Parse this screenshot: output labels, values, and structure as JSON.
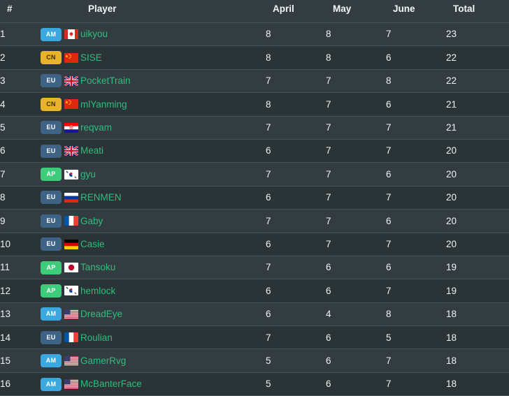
{
  "table": {
    "columns": [
      {
        "key": "rank",
        "label": "#"
      },
      {
        "key": "player",
        "label": "Player"
      },
      {
        "key": "april",
        "label": "April"
      },
      {
        "key": "may",
        "label": "May"
      },
      {
        "key": "june",
        "label": "June"
      },
      {
        "key": "total",
        "label": "Total"
      }
    ],
    "colors": {
      "page_background": "#343d41",
      "row_odd": "#333d41",
      "row_even": "#2a3336",
      "row_separator": "#4a5357",
      "header_text": "#f2f6f7",
      "body_text": "#eef2f4",
      "player_link": "#2fbd7e",
      "badge_am": "#3ba9e0",
      "badge_cn": "#e8b22a",
      "badge_eu": "#3f6384",
      "badge_ap": "#3dcc79"
    },
    "rows": [
      {
        "rank": "1",
        "region": "AM",
        "flag": "ca",
        "flag_name": "flag-canada",
        "player": "uikyou",
        "april": "8",
        "may": "8",
        "june": "7",
        "total": "23"
      },
      {
        "rank": "2",
        "region": "CN",
        "flag": "cn",
        "flag_name": "flag-china",
        "player": "SISE",
        "april": "8",
        "may": "8",
        "june": "6",
        "total": "22"
      },
      {
        "rank": "3",
        "region": "EU",
        "flag": "gb",
        "flag_name": "flag-united-kingdom",
        "player": "PocketTrain",
        "april": "7",
        "may": "7",
        "june": "8",
        "total": "22"
      },
      {
        "rank": "4",
        "region": "CN",
        "flag": "cn",
        "flag_name": "flag-china",
        "player": "mlYanming",
        "april": "8",
        "may": "7",
        "june": "6",
        "total": "21"
      },
      {
        "rank": "5",
        "region": "EU",
        "flag": "hr",
        "flag_name": "flag-croatia",
        "player": "reqvam",
        "april": "7",
        "may": "7",
        "june": "7",
        "total": "21"
      },
      {
        "rank": "6",
        "region": "EU",
        "flag": "gb",
        "flag_name": "flag-united-kingdom",
        "player": "Meati",
        "april": "6",
        "may": "7",
        "june": "7",
        "total": "20"
      },
      {
        "rank": "7",
        "region": "AP",
        "flag": "kr",
        "flag_name": "flag-south-korea",
        "player": "gyu",
        "april": "7",
        "may": "7",
        "june": "6",
        "total": "20"
      },
      {
        "rank": "8",
        "region": "EU",
        "flag": "ru",
        "flag_name": "flag-russia",
        "player": "RENMEN",
        "april": "6",
        "may": "7",
        "june": "7",
        "total": "20"
      },
      {
        "rank": "9",
        "region": "EU",
        "flag": "fr",
        "flag_name": "flag-france",
        "player": "Gaby",
        "april": "7",
        "may": "7",
        "june": "6",
        "total": "20"
      },
      {
        "rank": "10",
        "region": "EU",
        "flag": "de",
        "flag_name": "flag-germany",
        "player": "Casie",
        "april": "6",
        "may": "7",
        "june": "7",
        "total": "20"
      },
      {
        "rank": "11",
        "region": "AP",
        "flag": "jp",
        "flag_name": "flag-japan",
        "player": "Tansoku",
        "april": "7",
        "may": "6",
        "june": "6",
        "total": "19"
      },
      {
        "rank": "12",
        "region": "AP",
        "flag": "kr",
        "flag_name": "flag-south-korea",
        "player": "hemlock",
        "april": "6",
        "may": "6",
        "june": "7",
        "total": "19"
      },
      {
        "rank": "13",
        "region": "AM",
        "flag": "us",
        "flag_name": "flag-united-states",
        "player": "DreadEye",
        "april": "6",
        "may": "4",
        "june": "8",
        "total": "18"
      },
      {
        "rank": "14",
        "region": "EU",
        "flag": "fr",
        "flag_name": "flag-france",
        "player": "Roulian",
        "april": "7",
        "may": "6",
        "june": "5",
        "total": "18"
      },
      {
        "rank": "15",
        "region": "AM",
        "flag": "us",
        "flag_name": "flag-united-states",
        "player": "GamerRvg",
        "april": "5",
        "may": "6",
        "june": "7",
        "total": "18"
      },
      {
        "rank": "16",
        "region": "AM",
        "flag": "us",
        "flag_name": "flag-united-states",
        "player": "McBanterFace",
        "april": "5",
        "may": "6",
        "june": "7",
        "total": "18"
      }
    ]
  }
}
